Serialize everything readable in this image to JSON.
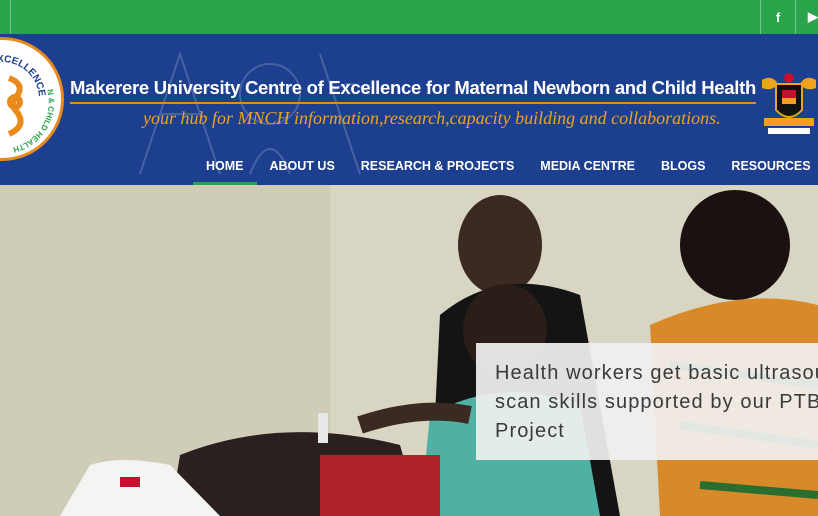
{
  "topbar": {
    "colors": {
      "background": "#2aa44a"
    },
    "social": [
      {
        "name": "facebook",
        "icon": "facebook-icon",
        "glyph": "f"
      },
      {
        "name": "youtube",
        "icon": "youtube-icon",
        "glyph": "▶"
      }
    ]
  },
  "header": {
    "title": "Makerere University Centre of Excellence for Maternal Newborn and Child Health",
    "tagline": "your hub for MNCH information,research,capacity building and collaborations.",
    "logo": {
      "icon": "mnch-coe-logo",
      "text_top": "EXCELLENCE",
      "text_bottom": "N & CHILD HEALTH"
    },
    "crest": {
      "icon": "makerere-university-crest"
    },
    "colors": {
      "background": "#1c3f8f",
      "accent": "#e98a1c",
      "tagline": "#f0a21f"
    }
  },
  "nav": {
    "items": [
      {
        "label": "HOME",
        "active": true
      },
      {
        "label": "ABOUT US",
        "active": false
      },
      {
        "label": "RESEARCH & PROJECTS",
        "active": false
      },
      {
        "label": "MEDIA CENTRE",
        "active": false
      },
      {
        "label": "BLOGS",
        "active": false
      },
      {
        "label": "RESOURCES",
        "active": false
      }
    ]
  },
  "hero": {
    "caption": "Health workers get basic ultrasound\nscan skills supported by our PTB\nProject"
  }
}
